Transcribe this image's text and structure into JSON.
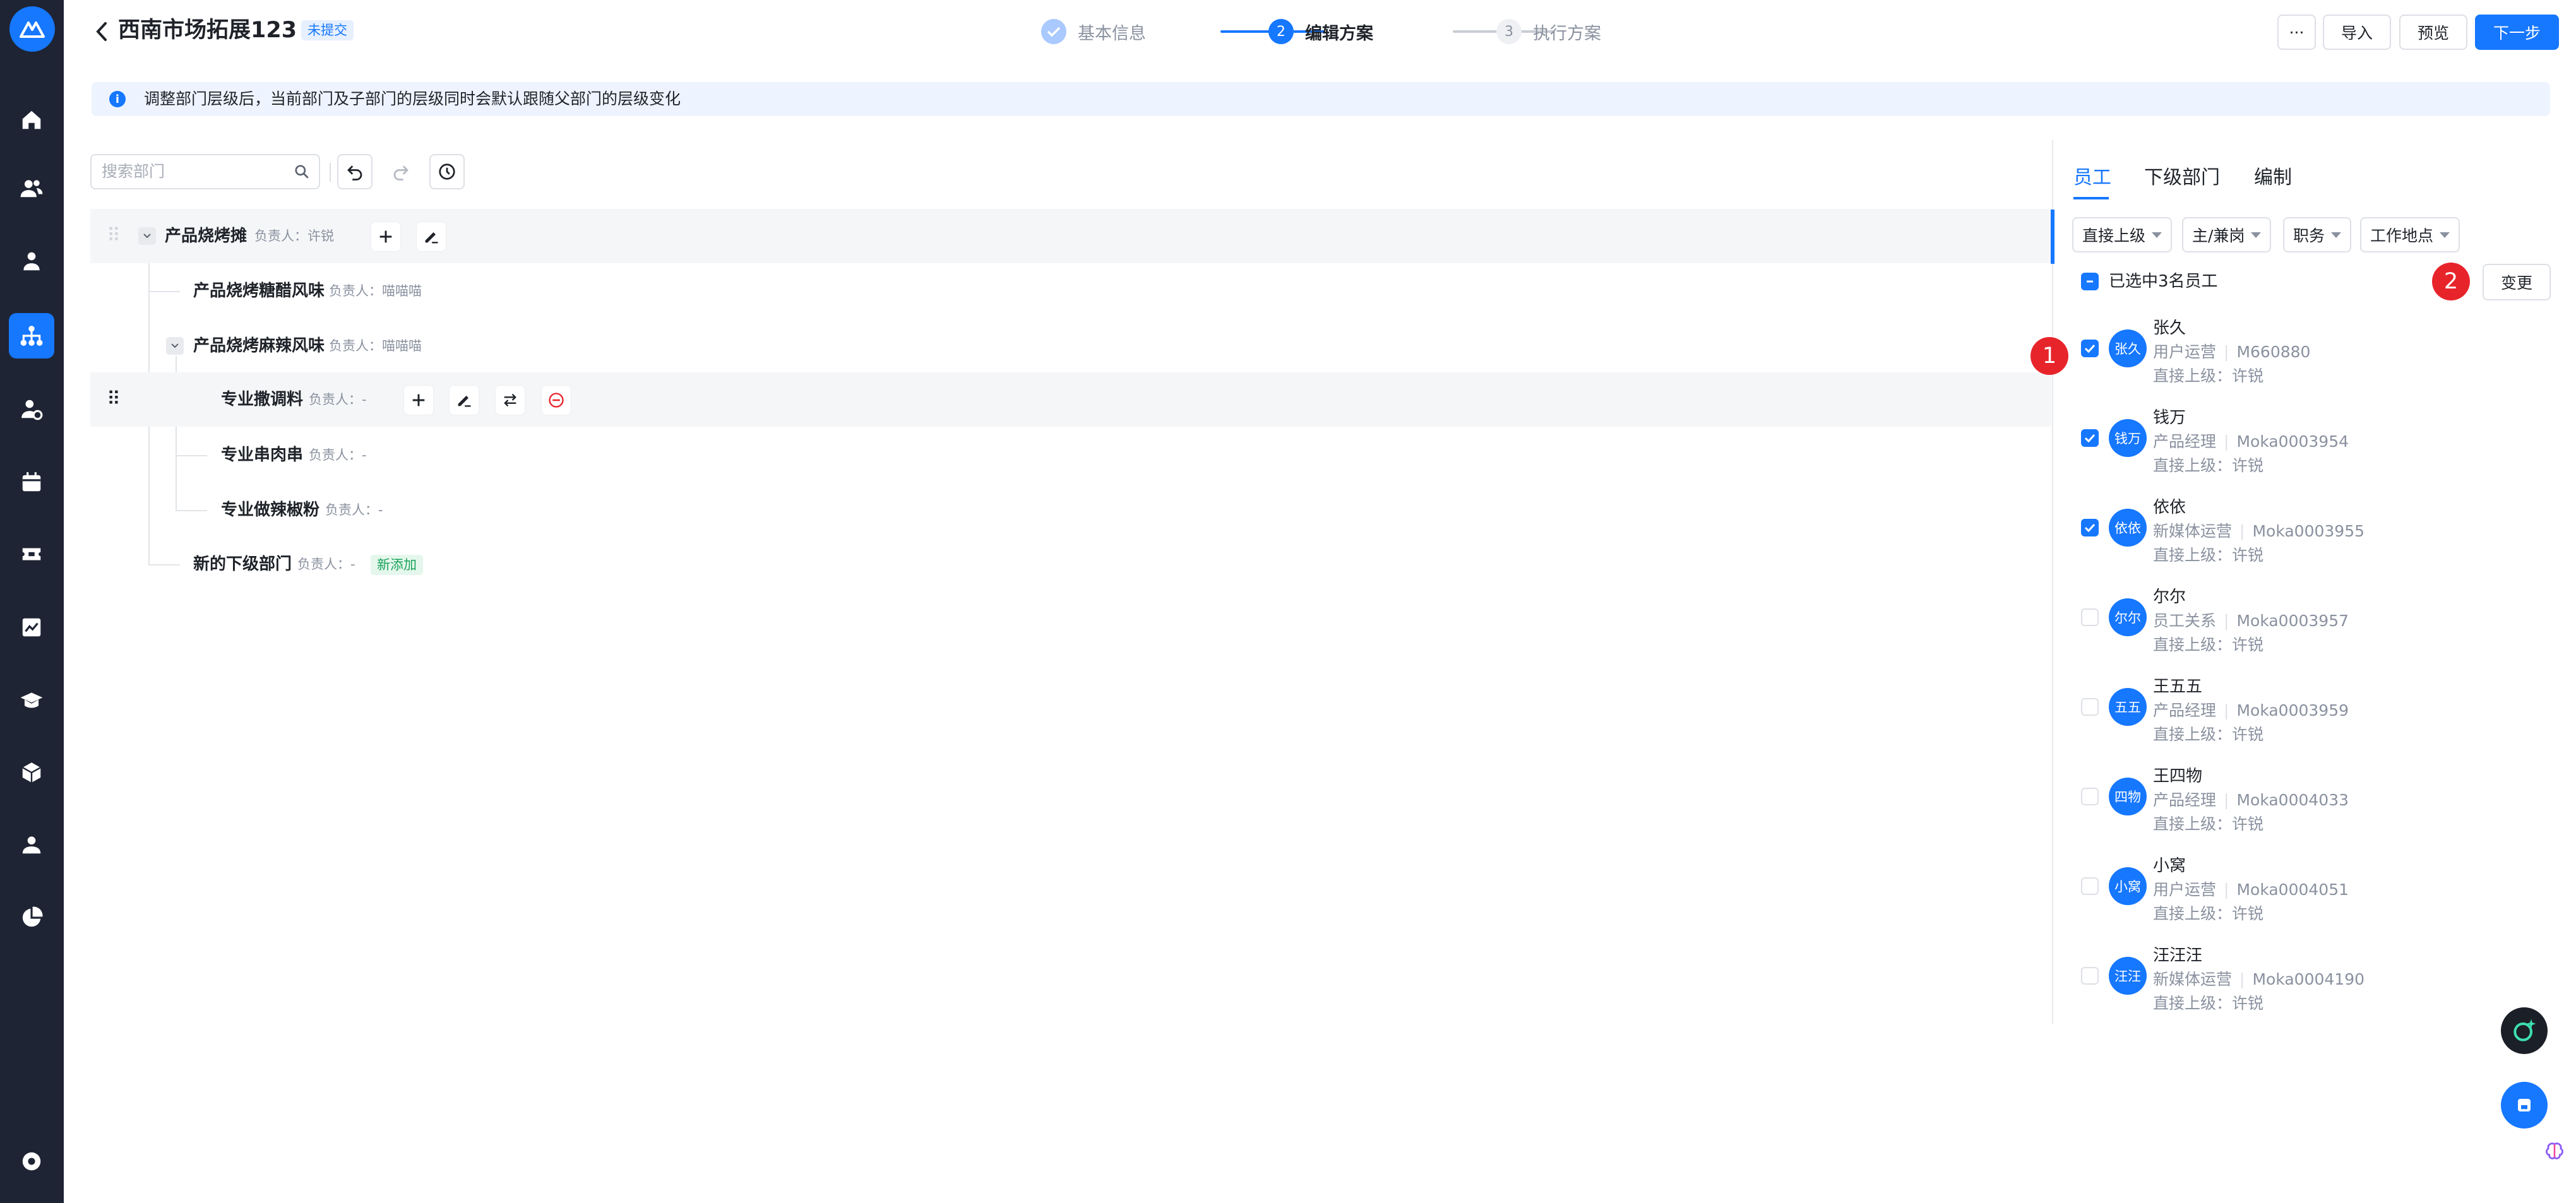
{
  "header": {
    "title": "西南市场拓展123",
    "status_badge": "未提交",
    "steps": [
      {
        "num": "✓",
        "label": "基本信息"
      },
      {
        "num": "2",
        "label": "编辑方案"
      },
      {
        "num": "3",
        "label": "执行方案"
      }
    ],
    "more_label": "···",
    "import_label": "导入",
    "preview_label": "预览",
    "next_label": "下一步"
  },
  "banner": {
    "icon": "info-icon",
    "text": "调整部门层级后，当前部门及子部门的层级同时会默认跟随父部门的层级变化"
  },
  "toolbar": {
    "search_placeholder": "搜索部门"
  },
  "tree": [
    {
      "name": "产品烧烤摊",
      "owner": "负责人：许锐"
    },
    {
      "name": "产品烧烤糖醋风味",
      "owner": "负责人：喵喵喵"
    },
    {
      "name": "产品烧烤麻辣风味",
      "owner": "负责人：喵喵喵"
    },
    {
      "name": "专业撒调料",
      "owner": "负责人：-"
    },
    {
      "name": "专业串肉串",
      "owner": "负责人：-"
    },
    {
      "name": "专业做辣椒粉",
      "owner": "负责人：-"
    },
    {
      "name": "新的下级部门",
      "owner": "负责人：-",
      "tag": "新添加"
    }
  ],
  "panel": {
    "tabs": [
      "员工",
      "下级部门",
      "编制"
    ],
    "filters": [
      "直接上级",
      "主/兼岗",
      "职务",
      "工作地点"
    ],
    "selected_text": "已选中3名员工",
    "change_label": "变更",
    "markers": [
      "1",
      "2"
    ],
    "employees": [
      {
        "name": "张久",
        "avatar": "张久",
        "role": "用户运营",
        "id": "M660880",
        "manager": "直接上级：许锐",
        "checked": true
      },
      {
        "name": "钱万",
        "avatar": "钱万",
        "role": "产品经理",
        "id": "Moka0003954",
        "manager": "直接上级：许锐",
        "checked": true
      },
      {
        "name": "依依",
        "avatar": "依依",
        "role": "新媒体运营",
        "id": "Moka0003955",
        "manager": "直接上级：许锐",
        "checked": true
      },
      {
        "name": "尔尔",
        "avatar": "尔尔",
        "role": "员工关系",
        "id": "Moka0003957",
        "manager": "直接上级：许锐",
        "checked": false
      },
      {
        "name": "王五五",
        "avatar": "五五",
        "role": "产品经理",
        "id": "Moka0003959",
        "manager": "直接上级：许锐",
        "checked": false
      },
      {
        "name": "王四物",
        "avatar": "四物",
        "role": "产品经理",
        "id": "Moka0004033",
        "manager": "直接上级：许锐",
        "checked": false
      },
      {
        "name": "小窝",
        "avatar": "小窝",
        "role": "用户运营",
        "id": "Moka0004051",
        "manager": "直接上级：许锐",
        "checked": false
      },
      {
        "name": "汪汪汪",
        "avatar": "汪汪",
        "role": "新媒体运营",
        "id": "Moka0004190",
        "manager": "直接上级：许锐",
        "checked": false
      }
    ]
  },
  "colors": {
    "accent": "#1677ff",
    "nav_bg": "#1e2433",
    "marker": "#e8242b",
    "new_tag": "#1aa35a"
  }
}
